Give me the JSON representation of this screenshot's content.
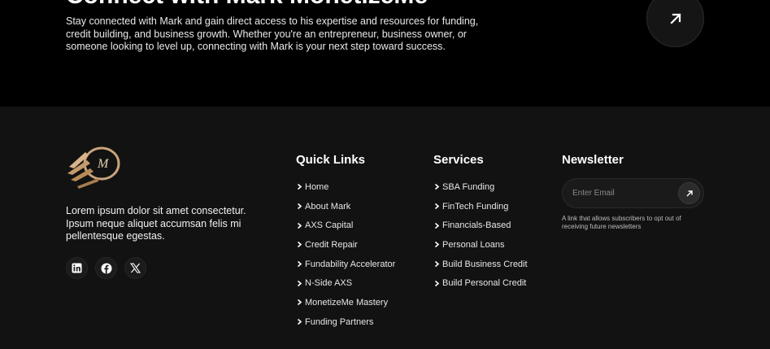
{
  "cta": {
    "title": "Connect with Mark MonetizeMe",
    "description": "Stay connected with Mark and gain direct access to his expertise and resources for funding, credit building, and business growth. Whether you're an entrepreneur, business owner, or someone looking to level up, connecting with Mark is your next step toward success.",
    "arrow_icon": "arrow-up-right-icon"
  },
  "footer": {
    "about": "Lorem ipsum dolor sit amet consectetur. Ipsum neque aliquet accumsan felis mi pellentesque egestas.",
    "socials": [
      "linkedin-icon",
      "facebook-icon",
      "x-twitter-icon"
    ],
    "quick_links": {
      "title": "Quick Links",
      "items": [
        "Home",
        "About Mark",
        "AXS Capital",
        "Credit Repair",
        "Fundability Accelerator",
        "N-Side AXS",
        "MonetizeMe Mastery",
        "Funding Partners"
      ]
    },
    "services": {
      "title": "Services",
      "items": [
        "SBA Funding",
        "FinTech Funding",
        "Financials-Based",
        "Personal Loans",
        "Build Business Credit",
        "Build Personal Credit"
      ]
    },
    "newsletter": {
      "title": "Newsletter",
      "placeholder": "Enter Email",
      "note": "A link that allows subscribers to opt out of receiving future newsletters"
    }
  },
  "colors": {
    "cta_bg": "#000000",
    "footer_bg": "#121212",
    "logo_gold": "#c9a47a"
  }
}
